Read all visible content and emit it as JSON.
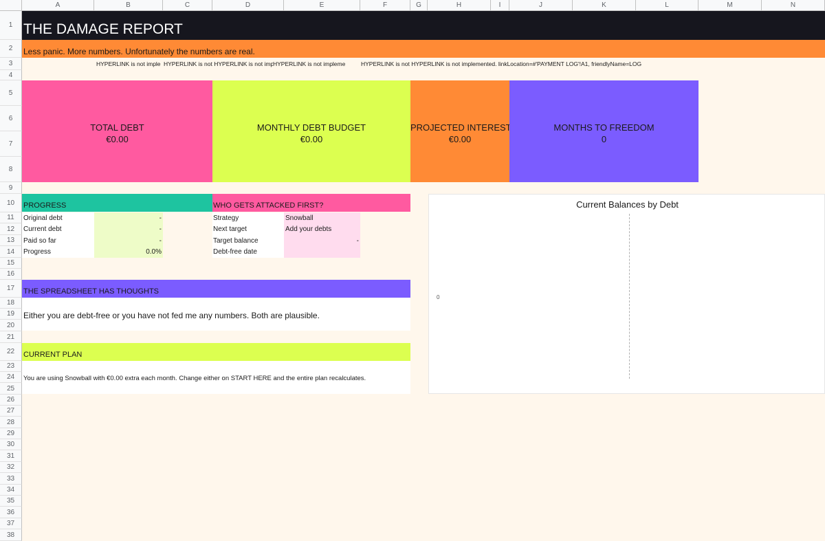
{
  "sheet": {
    "columns": [
      "A",
      "B",
      "C",
      "D",
      "E",
      "F",
      "G",
      "H",
      "I",
      "J",
      "K",
      "L",
      "M",
      "N"
    ],
    "rows": [
      "1",
      "2",
      "3",
      "4",
      "5",
      "6",
      "7",
      "8",
      "9",
      "10",
      "11",
      "12",
      "13",
      "14",
      "15",
      "16",
      "17",
      "18",
      "19",
      "20",
      "21",
      "22",
      "23",
      "24",
      "25",
      "26",
      "27",
      "28",
      "29",
      "30",
      "31",
      "32",
      "33",
      "34",
      "35",
      "36",
      "37",
      "38"
    ]
  },
  "header": {
    "title": "THE DAMAGE REPORT",
    "subtitle": "Less panic. More numbers. Unfortunately the numbers are real."
  },
  "links": [
    "HYPERLINK is not imple",
    "HYPERLINK is not HYPERLINK is not implem",
    "HYPERLINK is not impleme",
    "HYPERLINK is not HYPERLINK is not implemented. linkLocation=#'PAYMENT LOG'!A1, friendlyName=LOG"
  ],
  "kpis": [
    {
      "label": "TOTAL DEBT",
      "value": "€0.00",
      "color": "#ff5aa0"
    },
    {
      "label": "MONTHLY DEBT BUDGET",
      "value": "€0.00",
      "color": "#dcff50"
    },
    {
      "label": "PROJECTED INTEREST",
      "value": "€0.00",
      "color": "#ff8a35"
    },
    {
      "label": "MONTHS TO FREEDOM",
      "value": "0",
      "color": "#7b5cff"
    }
  ],
  "progress": {
    "title": "PROGRESS",
    "rows": [
      {
        "label": "Original debt",
        "value": "-"
      },
      {
        "label": "Current debt",
        "value": "-"
      },
      {
        "label": "Paid so far",
        "value": "-"
      },
      {
        "label": "Progress",
        "value": "0.0%"
      }
    ]
  },
  "attack": {
    "title": "WHO GETS ATTACKED FIRST?",
    "rows": [
      {
        "label": "Strategy",
        "value": "Snowball"
      },
      {
        "label": "Next target",
        "value": "Add your debts"
      },
      {
        "label": "Target balance",
        "value": "-"
      },
      {
        "label": "Debt-free date",
        "value": ""
      }
    ]
  },
  "thoughts": {
    "title": "THE SPREADSHEET HAS THOUGHTS",
    "text": "Either you are debt-free or you have not fed me any numbers. Both are plausible."
  },
  "plan": {
    "title": "CURRENT PLAN",
    "text": "You are using Snowball with €0.00 extra each month. Change either on START HERE and the entire plan recalculates."
  },
  "chart_data": {
    "type": "bar",
    "title": "Current Balances by Debt",
    "categories": [],
    "values": [],
    "axis_tick": "0"
  },
  "colors": {
    "title_bar": "#16161e",
    "subtitle_bar": "#ff8a35",
    "sheet_bg": "#fff7ec",
    "progress_header": "#1ec4a0",
    "progress_values": "#eefcc8",
    "attack_header": "#ff5aa0",
    "attack_values": "#ffdcee",
    "thoughts_header": "#7b5cff",
    "plan_header": "#dcff50"
  }
}
